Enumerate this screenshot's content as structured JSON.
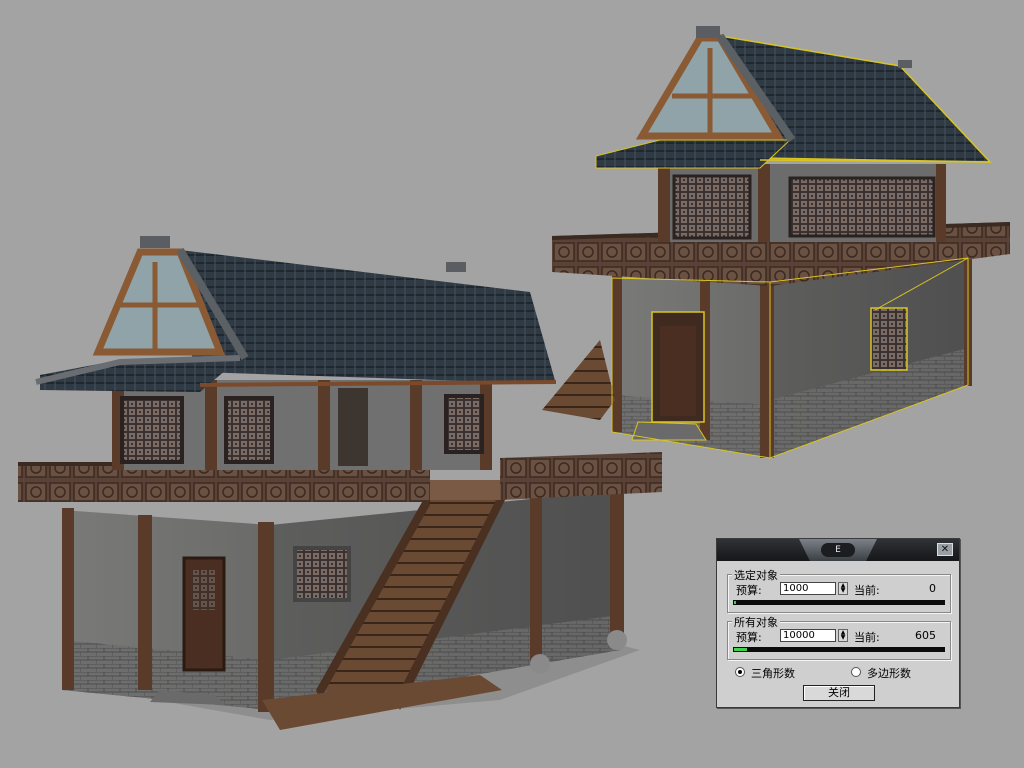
{
  "dialog": {
    "logo_text": "E",
    "close_icon": "x-icon",
    "selected": {
      "title": "选定对象",
      "budget_label": "预算:",
      "budget_value": "1000",
      "current_label": "当前:",
      "current_value": "0",
      "progress": 0.01
    },
    "all": {
      "title": "所有对象",
      "budget_label": "预算:",
      "budget_value": "10000",
      "current_label": "当前:",
      "current_value": "605",
      "progress": 0.06
    },
    "mode_triangles": "三角形数",
    "mode_polygons": "多边形数",
    "mode_selected": "triangles",
    "close_button": "关闭"
  },
  "colors": {
    "viewport_bg": "#a3a3a3",
    "selection_outline": "#d8c422",
    "progress_fill": "#3fd24a"
  }
}
